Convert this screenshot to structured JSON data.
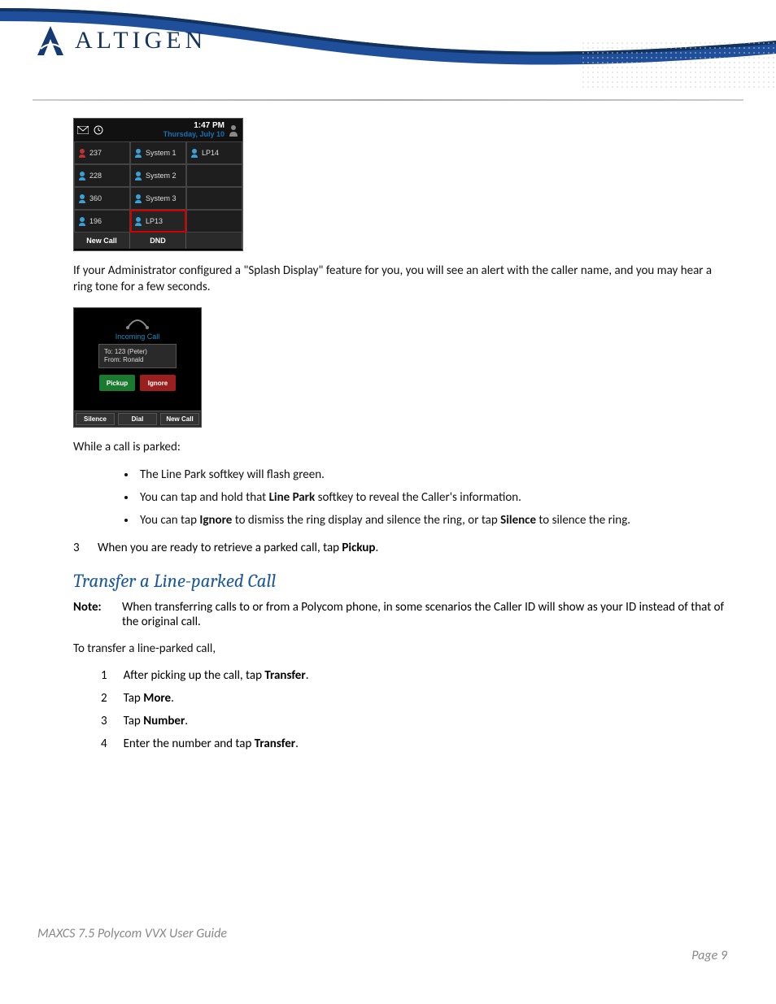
{
  "brand": {
    "name": "ALTIGEN"
  },
  "screenshot1": {
    "time": "1:47 PM",
    "date": "Thursday, July 10",
    "rows": [
      {
        "c1": "237",
        "c2": "System 1",
        "c3": "LP14",
        "c1_busy": true
      },
      {
        "c1": "228",
        "c2": "System 2",
        "c3": ""
      },
      {
        "c1": "360",
        "c2": "System 3",
        "c3": ""
      },
      {
        "c1": "196",
        "c2": "LP13",
        "c3": "",
        "c2_highlight": true
      }
    ],
    "softkeys": {
      "left": "New Call",
      "mid": "DND",
      "right": ""
    }
  },
  "para1": "If your Administrator configured a \"Splash Display\" feature for you, you will see an alert with the caller name, and you may hear a ring tone for a few seconds.",
  "screenshot2": {
    "banner": "Incoming Call",
    "to_label": "To:",
    "to_value": "123 (Peter)",
    "from_label": "From:",
    "from_value": "Ronald",
    "pickup": "Pickup",
    "ignore": "Ignore",
    "softkeys": [
      "Silence",
      "Dial",
      "New Call"
    ]
  },
  "para2": "While a call is parked:",
  "bullets": [
    {
      "pre": "The Line Park softkey will flash green.",
      "bold": null,
      "post": null
    },
    {
      "pre": "You can tap and hold that ",
      "bold": "Line Park",
      "post": " softkey to reveal the Caller's information."
    },
    {
      "pre": "You can tap ",
      "bold": "Ignore",
      "post": " to dismiss the ring display and silence the ring, or tap ",
      "bold2": "Silence",
      "post2": " to silence the ring."
    }
  ],
  "step3": {
    "num": "3",
    "pre": "When you are ready to retrieve a parked call, tap ",
    "bold": "Pickup",
    "post": "."
  },
  "section_heading": "Transfer a Line-parked Call",
  "note": {
    "label": "Note:",
    "text": "When transferring calls to or from a Polycom phone, in some scenarios the Caller ID will show as your ID instead of that of the original call."
  },
  "para3": "To transfer a line-parked call,",
  "steps": [
    {
      "n": "1",
      "pre": "After picking up the call, tap ",
      "bold": "Transfer",
      "post": "."
    },
    {
      "n": "2",
      "pre": "Tap ",
      "bold": "More",
      "post": "."
    },
    {
      "n": "3",
      "pre": "Tap ",
      "bold": "Number",
      "post": "."
    },
    {
      "n": "4",
      "pre": "Enter the number and tap ",
      "bold": "Transfer",
      "post": "."
    }
  ],
  "footer": {
    "title": "MAXCS 7.5 Polycom VVX User Guide",
    "page": "Page 9"
  }
}
